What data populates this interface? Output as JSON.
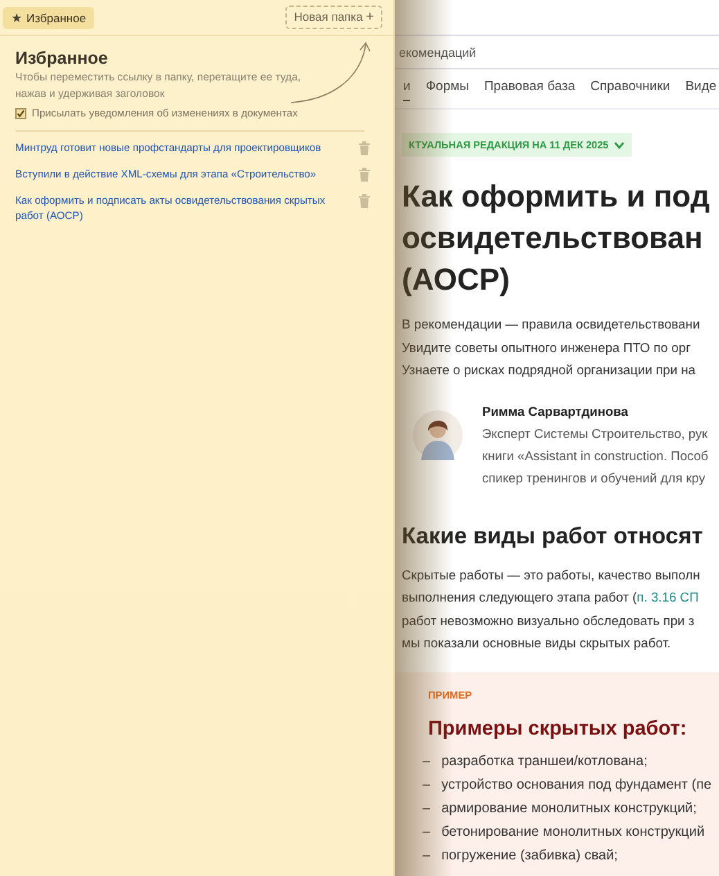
{
  "favorites_panel": {
    "tab": {
      "label": "Избранное",
      "icon": "★"
    },
    "new_folder_button": {
      "label": "Новая папка",
      "icon": "+"
    },
    "title": "Избранное",
    "hint": "Чтобы переместить ссылку в папку, перетащите ее туда, нажав и удерживая заголовок",
    "notify_checkbox": {
      "label": "Присылать уведомления об изменениях в документах",
      "checked": true
    },
    "links": [
      {
        "title": "Минтруд готовит новые профстандарты для проектировщиков"
      },
      {
        "title": "Вступили в действие XML-схемы для этапа «Строительство»"
      },
      {
        "title": "Как оформить и подписать акты освидетельствования скрытых работ (АОСР)"
      }
    ]
  },
  "article": {
    "search": {
      "value": "екомендаций"
    },
    "nav_tabs": [
      {
        "label": "и",
        "selected": true
      },
      {
        "label": "Формы",
        "selected": false
      },
      {
        "label": "Правовая база",
        "selected": false
      },
      {
        "label": "Справочники",
        "selected": false
      },
      {
        "label": "Виде",
        "selected": false
      }
    ],
    "edition_badge": "КТУАЛЬНАЯ РЕДАКЦИЯ НА 11 ДЕК 2025",
    "title_lines": [
      "Как оформить и под",
      "освидетельствован",
      "(АОСР)"
    ],
    "intro_lines": [
      "В рекомендации — правила освидетельствовани",
      "Увидите советы опытного инженера ПТО по орг",
      "Узнаете о рисках подрядной организации при на"
    ],
    "author": {
      "name": "Римма Сарвартдинова",
      "bio_lines": [
        "Эксперт Системы Строительство, рук",
        "книги «Assistant in construction. Пособ",
        "спикер тренингов и обучений для кру"
      ]
    },
    "section_title": "Какие виды работ относят",
    "section_lines": [
      {
        "text": "Скрытые работы — это работы, качество выполн"
      },
      {
        "text": "выполнения следующего этапа работ (",
        "link": "п. 3.16 СП"
      },
      {
        "text": "работ невозможно визуально обследовать при з"
      },
      {
        "text": "мы показали основные виды скрытых работ."
      }
    ],
    "example": {
      "label": "ПРИМЕР",
      "title": "Примеры скрытых работ:",
      "marker": "–",
      "items": [
        "разработка траншеи/котлована;",
        "устройство основания под фундамент (пе",
        "армирование монолитных конструкций;",
        "бетонирование монолитных конструкций",
        "погружение (забивка) свай;"
      ]
    }
  }
}
